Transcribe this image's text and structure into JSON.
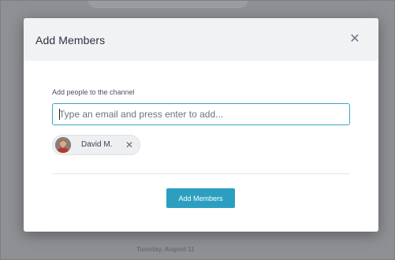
{
  "background": {
    "date_divider": "Tuesday, August 11"
  },
  "modal": {
    "title": "Add Members",
    "close_icon": "close-icon",
    "field_label": "Add people to the channel",
    "email_input": {
      "value": "",
      "placeholder": "Type an email and press enter to add..."
    },
    "selected_members": [
      {
        "name": "David M.",
        "remove_icon": "close-icon"
      }
    ],
    "submit_label": "Add Members"
  },
  "colors": {
    "accent": "#2c9fc0",
    "input_focus_border": "#3aa5c2",
    "header_bg": "#f1f2f4"
  }
}
